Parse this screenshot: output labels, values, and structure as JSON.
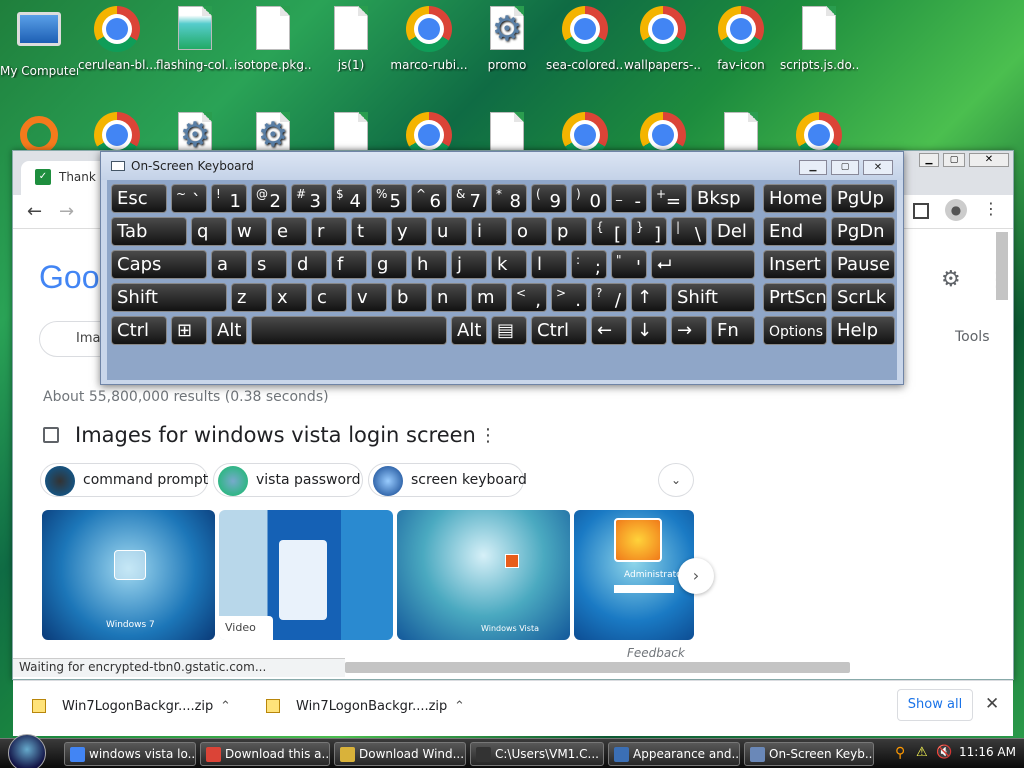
{
  "desktop_icons_row1": [
    {
      "label": "My Computer",
      "icon": "computer-icon"
    },
    {
      "label": "cerulean-bl...",
      "icon": "chrome-icon"
    },
    {
      "label": "flashing-col...",
      "icon": "image-file-icon"
    },
    {
      "label": "isotope.pkg...",
      "icon": "file-icon"
    },
    {
      "label": "js(1)",
      "icon": "file-icon"
    },
    {
      "label": "marco-rubi...",
      "icon": "chrome-icon"
    },
    {
      "label": "promo",
      "icon": "settings-file-icon"
    },
    {
      "label": "sea-colored...",
      "icon": "chrome-icon"
    },
    {
      "label": "wallpapers-...",
      "icon": "chrome-icon"
    },
    {
      "label": "fav-icon",
      "icon": "chrome-icon"
    },
    {
      "label": "scripts.js.do...",
      "icon": "file-icon"
    }
  ],
  "browser": {
    "tab_title": "Thank y",
    "google_logo": "Goog",
    "images_tab": "Imag",
    "tools": "Tools",
    "results_count": "About 55,800,000 results (0.38 seconds)",
    "images_heading": "Images for windows vista login screen",
    "chips": [
      "command prompt",
      "vista password",
      "screen keyboard"
    ],
    "video_badge": "Video",
    "feedback": "Feedback",
    "status": "Waiting for encrypted-tbn0.gstatic.com...",
    "thumb_captions": [
      "Windows 7",
      "",
      "Windows Vista",
      "Administrator"
    ],
    "downloads": [
      "Win7LogonBackgr....zip",
      "Win7LogonBackgr....zip"
    ],
    "show_all": "Show all"
  },
  "osk": {
    "title": "On-Screen Keyboard"
  },
  "keyboard_rows": [
    [
      {
        "sup": "",
        "main": "Esc"
      },
      {
        "sup": "~",
        "main": "`"
      },
      {
        "sup": "!",
        "main": "1"
      },
      {
        "sup": "@",
        "main": "2"
      },
      {
        "sup": "#",
        "main": "3"
      },
      {
        "sup": "$",
        "main": "4"
      },
      {
        "sup": "%",
        "main": "5"
      },
      {
        "sup": "^",
        "main": "6"
      },
      {
        "sup": "&",
        "main": "7"
      },
      {
        "sup": "*",
        "main": "8"
      },
      {
        "sup": "(",
        "main": "9"
      },
      {
        "sup": ")",
        "main": "0"
      },
      {
        "sup": "_",
        "main": "-"
      },
      {
        "sup": "+",
        "main": "="
      },
      {
        "sup": "",
        "main": "Bksp"
      },
      {
        "sup": "",
        "main": "Home"
      },
      {
        "sup": "",
        "main": "PgUp"
      }
    ],
    [
      {
        "sup": "",
        "main": "Tab"
      },
      {
        "sup": "",
        "main": "q"
      },
      {
        "sup": "",
        "main": "w"
      },
      {
        "sup": "",
        "main": "e"
      },
      {
        "sup": "",
        "main": "r"
      },
      {
        "sup": "",
        "main": "t"
      },
      {
        "sup": "",
        "main": "y"
      },
      {
        "sup": "",
        "main": "u"
      },
      {
        "sup": "",
        "main": "i"
      },
      {
        "sup": "",
        "main": "o"
      },
      {
        "sup": "",
        "main": "p"
      },
      {
        "sup": "{",
        "main": "["
      },
      {
        "sup": "}",
        "main": "]"
      },
      {
        "sup": "|",
        "main": "\\"
      },
      {
        "sup": "",
        "main": "Del"
      },
      {
        "sup": "",
        "main": "End"
      },
      {
        "sup": "",
        "main": "PgDn"
      }
    ],
    [
      {
        "sup": "",
        "main": "Caps"
      },
      {
        "sup": "",
        "main": "a"
      },
      {
        "sup": "",
        "main": "s"
      },
      {
        "sup": "",
        "main": "d"
      },
      {
        "sup": "",
        "main": "f"
      },
      {
        "sup": "",
        "main": "g"
      },
      {
        "sup": "",
        "main": "h"
      },
      {
        "sup": "",
        "main": "j"
      },
      {
        "sup": "",
        "main": "k"
      },
      {
        "sup": "",
        "main": "l"
      },
      {
        "sup": ":",
        "main": ";"
      },
      {
        "sup": "\"",
        "main": "'"
      },
      {
        "sup": "",
        "main": "⮠"
      },
      {
        "sup": "",
        "main": "Insert"
      },
      {
        "sup": "",
        "main": "Pause"
      }
    ],
    [
      {
        "sup": "",
        "main": "Shift"
      },
      {
        "sup": "",
        "main": "z"
      },
      {
        "sup": "",
        "main": "x"
      },
      {
        "sup": "",
        "main": "c"
      },
      {
        "sup": "",
        "main": "v"
      },
      {
        "sup": "",
        "main": "b"
      },
      {
        "sup": "",
        "main": "n"
      },
      {
        "sup": "",
        "main": "m"
      },
      {
        "sup": "<",
        "main": ","
      },
      {
        "sup": ">",
        "main": "."
      },
      {
        "sup": "?",
        "main": "/"
      },
      {
        "sup": "",
        "main": "↑"
      },
      {
        "sup": "",
        "main": "Shift"
      },
      {
        "sup": "",
        "main": "PrtScn"
      },
      {
        "sup": "",
        "main": "ScrLk"
      }
    ],
    [
      {
        "sup": "",
        "main": "Ctrl"
      },
      {
        "sup": "",
        "main": "⊞"
      },
      {
        "sup": "",
        "main": "Alt"
      },
      {
        "sup": "",
        "main": ""
      },
      {
        "sup": "",
        "main": "Alt"
      },
      {
        "sup": "",
        "main": "▤"
      },
      {
        "sup": "",
        "main": "Ctrl"
      },
      {
        "sup": "",
        "main": "←"
      },
      {
        "sup": "",
        "main": "↓"
      },
      {
        "sup": "",
        "main": "→"
      },
      {
        "sup": "",
        "main": "Fn"
      },
      {
        "sup": "",
        "main": "Options"
      },
      {
        "sup": "",
        "main": "Help"
      }
    ]
  ],
  "taskbar": {
    "items": [
      "windows vista lo...",
      "Download this a...",
      "Download Wind...",
      "C:\\Users\\VM1.C...",
      "Appearance and...",
      "On-Screen Keyb..."
    ],
    "clock": "11:16 AM"
  }
}
